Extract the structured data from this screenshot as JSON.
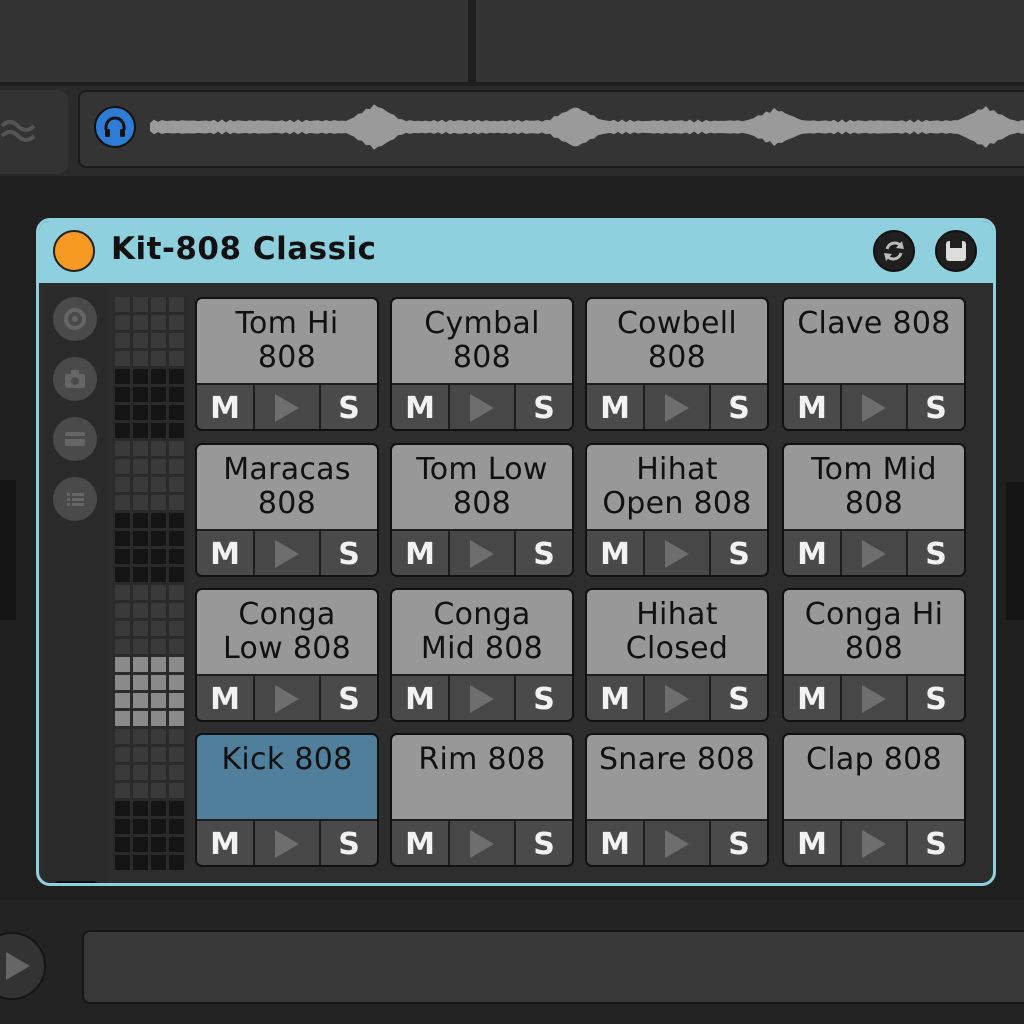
{
  "device": {
    "title": "Kit-808 Classic",
    "accent_color": "#8fd0df",
    "power_color": "#f69a23"
  },
  "icons": {
    "headphones": "headphones-icon",
    "hot_swap": "hot-swap-icon",
    "save": "save-icon",
    "side": [
      "preset-icon",
      "camera-icon",
      "card-icon",
      "list-icon"
    ],
    "play_view": "play-view-icon"
  },
  "pad_control_labels": {
    "mute": "M",
    "solo": "S"
  },
  "pads": [
    {
      "name": "Tom Hi\n808",
      "selected": false
    },
    {
      "name": "Cymbal\n808",
      "selected": false
    },
    {
      "name": "Cowbell\n808",
      "selected": false
    },
    {
      "name": "Clave 808",
      "selected": false
    },
    {
      "name": "Maracas\n808",
      "selected": false
    },
    {
      "name": "Tom Low\n808",
      "selected": false
    },
    {
      "name": "Hihat\nOpen 808",
      "selected": false
    },
    {
      "name": "Tom Mid\n808",
      "selected": false
    },
    {
      "name": "Conga\nLow 808",
      "selected": false
    },
    {
      "name": "Conga\nMid 808",
      "selected": false
    },
    {
      "name": "Hihat\nClosed",
      "selected": false
    },
    {
      "name": "Conga Hi\n808",
      "selected": false
    },
    {
      "name": "Kick 808",
      "selected": true
    },
    {
      "name": "Rim 808",
      "selected": false
    },
    {
      "name": "Snare 808",
      "selected": false
    },
    {
      "name": "Clap 808",
      "selected": false
    }
  ]
}
